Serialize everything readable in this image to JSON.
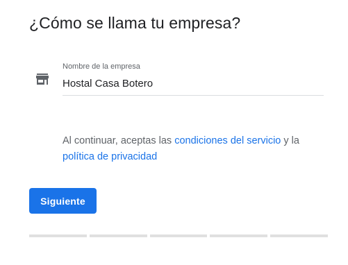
{
  "page": {
    "title": "¿Cómo se llama tu empresa?"
  },
  "business_name_field": {
    "label": "Nombre de la empresa",
    "value": "Hostal Casa Botero",
    "icon": "store-icon"
  },
  "terms": {
    "prefix": "Al continuar, aceptas las ",
    "terms_link": "condiciones del servicio",
    "middle": " y la ",
    "privacy_link": "política de privacidad"
  },
  "actions": {
    "next_label": "Siguiente"
  },
  "progress": {
    "total_steps": 5,
    "completed_steps": 0
  },
  "colors": {
    "accent": "#1a73e8",
    "text": "#202124",
    "muted": "#5f6368",
    "divider": "#dadce0"
  }
}
